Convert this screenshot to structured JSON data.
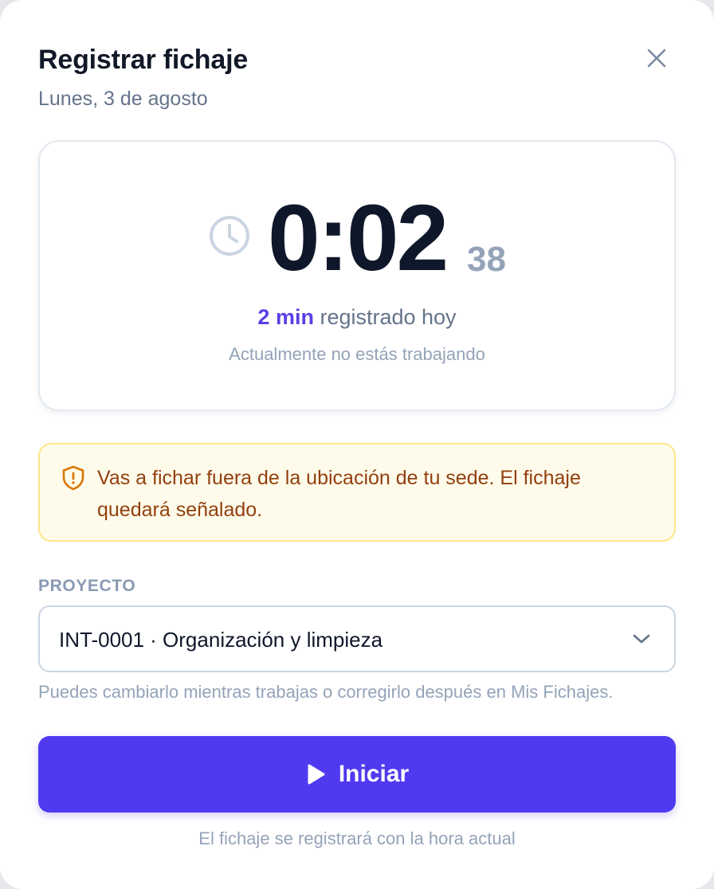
{
  "dialog": {
    "title": "Registrar fichaje",
    "date": "Lunes, 3 de agosto",
    "close_icon": "close-icon"
  },
  "timer": {
    "hours_minutes": "0:02",
    "seconds": "38",
    "registered_amount": "2 min",
    "registered_suffix": " registrado hoy",
    "status": "Actualmente no estás trabajando",
    "icon": "clock-icon"
  },
  "warning": {
    "icon": "shield-alert-icon",
    "text": "Vas a fichar fuera de la ubicación de tu sede. El fichaje quedará señalado.",
    "colors": {
      "background": "#fffbeb",
      "border": "#fde68a",
      "text": "#92400e"
    }
  },
  "project": {
    "label": "PROYECTO",
    "selected": "INT-0001 · Organización y limpieza",
    "helper": "Puedes cambiarlo mientras trabajas o corregirlo después en Mis Fichajes.",
    "icon": "chevron-down-icon"
  },
  "start_button": {
    "label": "Iniciar",
    "icon": "play-icon",
    "color": "#4f3af0"
  },
  "footnote": "El fichaje se registrará con la hora actual",
  "accent_color": "#5b3ee8"
}
